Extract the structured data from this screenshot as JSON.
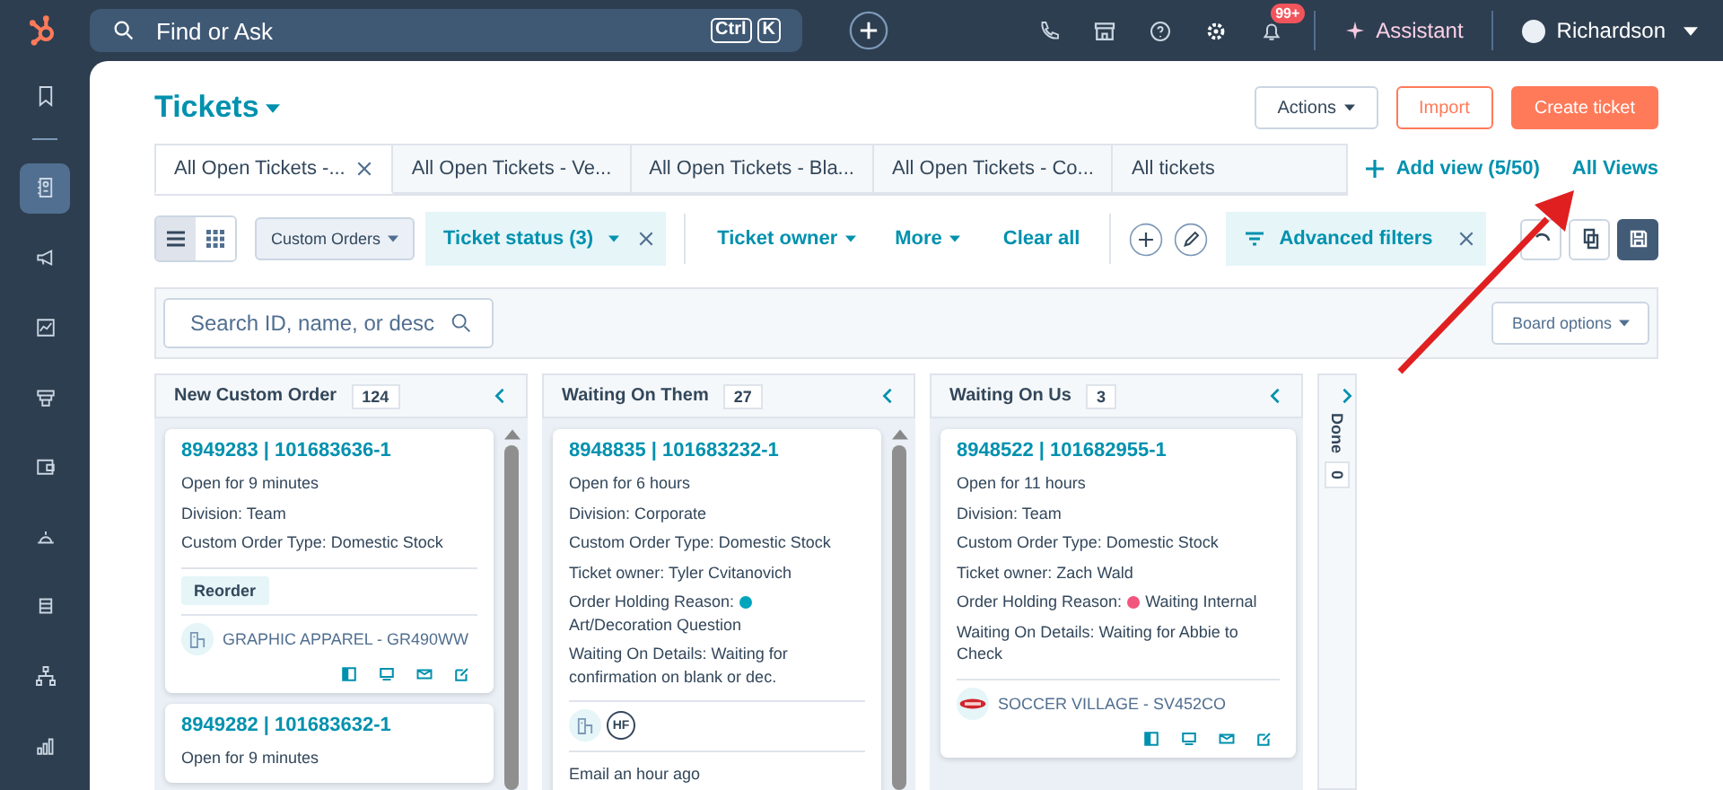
{
  "topbar": {
    "search_placeholder": "Find or Ask",
    "shortcut_keys": [
      "Ctrl",
      "K"
    ],
    "notification_badge": "99+",
    "assistant": "Assistant",
    "user": "Richardson"
  },
  "sidebar": {
    "items": [
      {
        "selected": false
      },
      {
        "selected": true
      },
      {
        "selected": false
      },
      {
        "selected": false
      },
      {
        "selected": false
      },
      {
        "selected": false
      },
      {
        "selected": false
      },
      {
        "selected": false
      },
      {
        "selected": false
      },
      {
        "selected": false
      }
    ]
  },
  "page": {
    "title": "Tickets",
    "buttons": [
      {
        "label": "Actions",
        "kind": "menu"
      },
      {
        "label": "Import",
        "kind": "outline"
      },
      {
        "label": "Create ticket",
        "kind": "primary"
      }
    ]
  },
  "view_tabs": [
    {
      "label": "All Open Tickets -...",
      "selected": true,
      "closable": true
    },
    {
      "label": "All Open Tickets - Ve...",
      "selected": false,
      "closable": false
    },
    {
      "label": "All Open Tickets - Bla...",
      "selected": false,
      "closable": false
    },
    {
      "label": "All Open Tickets - Co...",
      "selected": false,
      "closable": false
    },
    {
      "label": "All tickets",
      "selected": false,
      "closable": false
    }
  ],
  "add_view": "Add view (5/50)",
  "all_views": "All Views",
  "toolbar": {
    "view_modes": [
      {
        "kind": "list",
        "selected": true
      },
      {
        "kind": "board",
        "selected": false
      }
    ],
    "pipeline": "Custom Orders",
    "filters": [
      {
        "label": "Ticket status (3)",
        "kind": "applied"
      },
      {
        "label": "Ticket owner",
        "kind": "dropdown"
      },
      {
        "label": "More",
        "kind": "dropdown"
      }
    ],
    "clear_all": "Clear all",
    "advanced_filters": "Advanced filters"
  },
  "board": {
    "search_placeholder": "Search ID, name, or desc",
    "board_options": "Board options",
    "columns": [
      {
        "name": "New Custom Order",
        "count": "124",
        "collapsed": false,
        "scrollbar": true,
        "cards": [
          {
            "title": "8949283 | 101683636-1",
            "lines": [
              {
                "kind": "text",
                "text": "Open for 9 minutes"
              },
              {
                "kind": "text",
                "text": "Division: Team"
              },
              {
                "kind": "text",
                "text": "Custom Order Type: Domestic Stock"
              }
            ],
            "tag": "Reorder",
            "avatars": [
              {
                "kind": "building"
              }
            ],
            "company": "GRAPHIC APPAREL - GR490WW",
            "actions": true
          },
          {
            "title": "8949282 | 101683632-1",
            "lines": [
              {
                "kind": "text",
                "text": "Open for 9 minutes"
              }
            ]
          }
        ]
      },
      {
        "name": "Waiting On Them",
        "count": "27",
        "collapsed": false,
        "scrollbar": true,
        "cards": [
          {
            "title": "8948835 | 101683232-1",
            "lines": [
              {
                "kind": "text",
                "text": "Open for 6 hours"
              },
              {
                "kind": "text",
                "text": "Division: Corporate"
              },
              {
                "kind": "text",
                "text": "Custom Order Type: Domestic Stock"
              },
              {
                "kind": "text",
                "text": "Ticket owner: Tyler Cvitanovich"
              },
              {
                "kind": "status",
                "label": "Order Holding Reason:",
                "value": "Art/Decoration Question",
                "color": "#00a4bd"
              },
              {
                "kind": "text",
                "text": "Waiting On Details: Waiting for confirmation on blank or dec."
              }
            ],
            "avatars": [
              {
                "kind": "building"
              },
              {
                "kind": "monogram",
                "text": "HF"
              }
            ],
            "activity": "Email an hour ago"
          }
        ]
      },
      {
        "name": "Waiting On Us",
        "count": "3",
        "collapsed": false,
        "scrollbar": false,
        "cards": [
          {
            "title": "8948522 | 101682955-1",
            "lines": [
              {
                "kind": "text",
                "text": "Open for 11 hours"
              },
              {
                "kind": "text",
                "text": "Division: Team"
              },
              {
                "kind": "text",
                "text": "Custom Order Type: Domestic Stock"
              },
              {
                "kind": "text",
                "text": "Ticket owner: Zach Wald"
              },
              {
                "kind": "status",
                "label": "Order Holding Reason:",
                "value": "Waiting Internal",
                "color": "#f2547d"
              },
              {
                "kind": "text",
                "text": "Waiting On Details: Waiting for Abbie to Check"
              }
            ],
            "avatars": [
              {
                "kind": "logo"
              }
            ],
            "company": "SOCCER VILLAGE - SV452CO",
            "actions": true
          }
        ]
      },
      {
        "name": "Done",
        "count": "0",
        "collapsed": true
      }
    ]
  }
}
